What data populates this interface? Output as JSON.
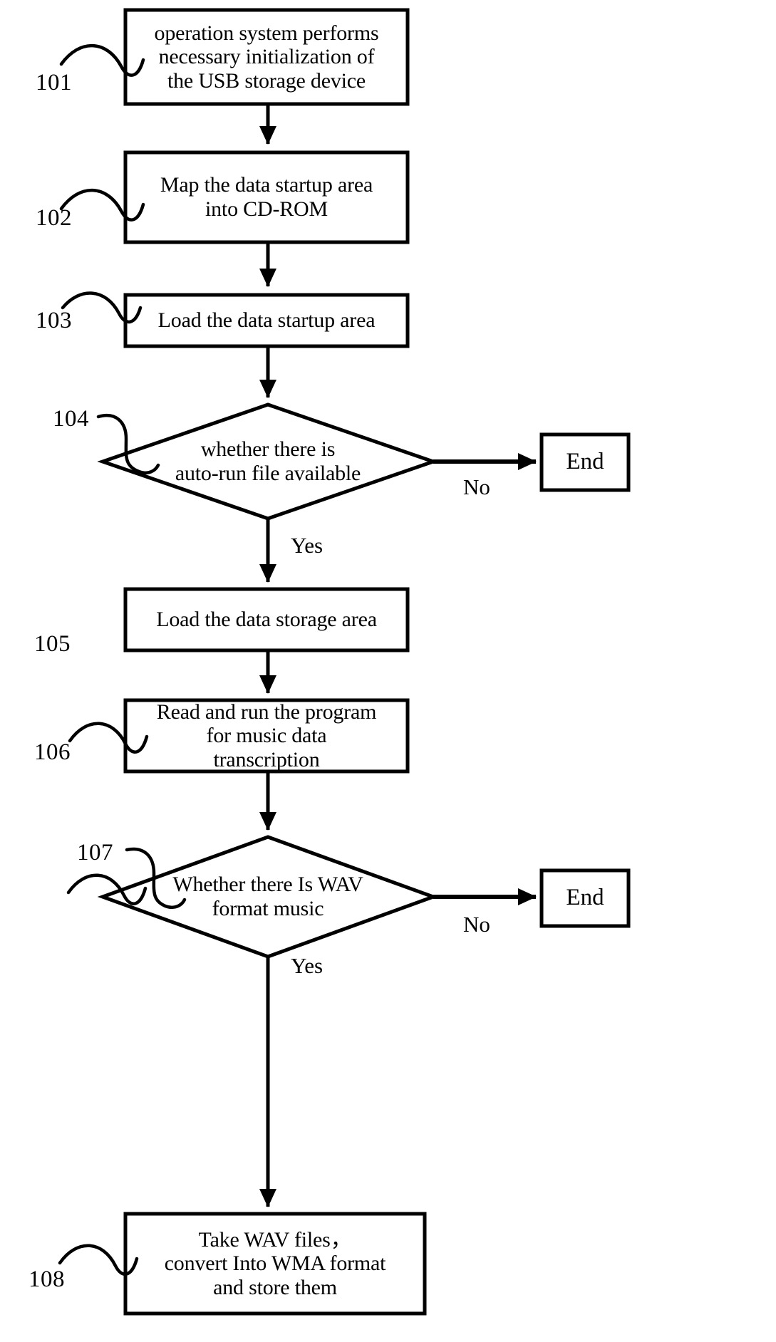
{
  "diagram": {
    "title": "USB storage device auto-run music transcription flowchart",
    "stroke_color": "#000000",
    "background_color": "#ffffff",
    "nodes": [
      {
        "id": "101",
        "ref": "101",
        "shape": "process",
        "lines": [
          "operation system performs",
          "necessary initialization of",
          "the USB storage device"
        ]
      },
      {
        "id": "102",
        "ref": "102",
        "shape": "process",
        "lines": [
          "Map the data startup area",
          "into CD-ROM"
        ]
      },
      {
        "id": "103",
        "ref": "103",
        "shape": "process",
        "lines": [
          "Load the data startup area"
        ]
      },
      {
        "id": "104",
        "ref": "104",
        "shape": "decision",
        "lines": [
          "whether there is",
          "auto-run file available"
        ]
      },
      {
        "id": "105",
        "ref": "105",
        "shape": "process",
        "lines": [
          "Load the data storage area"
        ]
      },
      {
        "id": "106",
        "ref": "106",
        "shape": "process",
        "lines": [
          "Read and run the program",
          "for music data",
          "transcription"
        ]
      },
      {
        "id": "107",
        "ref": "107",
        "shape": "decision",
        "lines": [
          "Whether there Is WAV",
          "format music"
        ]
      },
      {
        "id": "108",
        "ref": "108",
        "shape": "process",
        "lines": [
          "Take WAV files，",
          "convert Into WMA format",
          "and store them"
        ]
      }
    ],
    "terminals": [
      {
        "id": "end-1",
        "label": "End"
      },
      {
        "id": "end-2",
        "label": "End"
      }
    ],
    "edge_labels": [
      {
        "id": "no-1",
        "text": "No"
      },
      {
        "id": "yes-1",
        "text": "Yes"
      },
      {
        "id": "no-2",
        "text": "No"
      },
      {
        "id": "yes-2",
        "text": "Yes"
      }
    ]
  }
}
